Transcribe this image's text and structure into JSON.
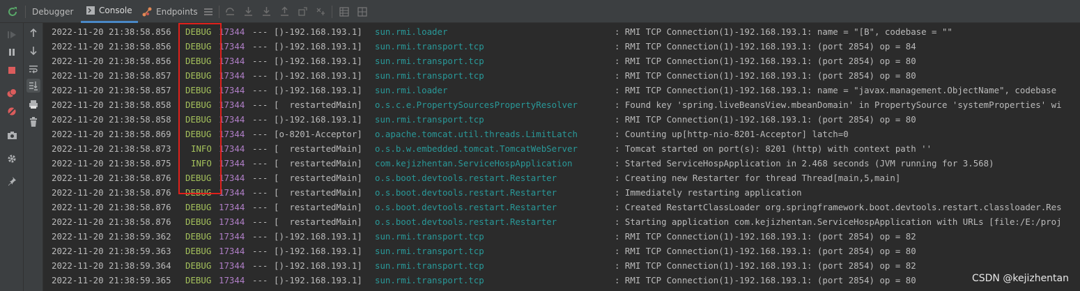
{
  "toolbar": {
    "rerun_icon": "rerun-icon",
    "tabs": [
      {
        "label": "Debugger",
        "icon": "",
        "active": false
      },
      {
        "label": "Console",
        "icon": "console-icon",
        "active": true
      },
      {
        "label": "Endpoints",
        "icon": "endpoints-icon",
        "active": false
      }
    ],
    "icons": [
      "menu-icon",
      "step-over-icon",
      "step-into-icon",
      "force-step-into-icon",
      "step-out-icon",
      "drop-frame-icon",
      "run-to-cursor-icon",
      "evaluate-icon",
      "table-icon",
      "watches-icon"
    ]
  },
  "leftbar": {
    "icons": [
      "resume-icon",
      "pause-icon",
      "stop-icon",
      "breakpoints-icon",
      "mute-breakpoints-icon",
      "camera-icon",
      "settings-icon",
      "pin-icon"
    ]
  },
  "leftbar2": {
    "icons": [
      "up-arrow-icon",
      "down-arrow-icon",
      "soft-wrap-icon",
      "scroll-to-end-icon",
      "print-icon",
      "trash-icon"
    ]
  },
  "colors": {
    "debug": "#a5c25c",
    "info": "#a5c25c",
    "pid": "#b07fc7",
    "logger": "#299999",
    "highlight": "#e0201b"
  },
  "console": {
    "lines": [
      {
        "ts": "2022-11-20 21:38:58.856",
        "level": "DEBUG",
        "pid": "17344",
        "sep": "---",
        "thread": "[)-192.168.193.1]",
        "logger": "sun.rmi.loader",
        "msg": ": RMI TCP Connection(1)-192.168.193.1: name = \"[B\", codebase = \"\""
      },
      {
        "ts": "2022-11-20 21:38:58.856",
        "level": "DEBUG",
        "pid": "17344",
        "sep": "---",
        "thread": "[)-192.168.193.1]",
        "logger": "sun.rmi.transport.tcp",
        "msg": ": RMI TCP Connection(1)-192.168.193.1: (port 2854) op = 84"
      },
      {
        "ts": "2022-11-20 21:38:58.856",
        "level": "DEBUG",
        "pid": "17344",
        "sep": "---",
        "thread": "[)-192.168.193.1]",
        "logger": "sun.rmi.transport.tcp",
        "msg": ": RMI TCP Connection(1)-192.168.193.1: (port 2854) op = 80"
      },
      {
        "ts": "2022-11-20 21:38:58.857",
        "level": "DEBUG",
        "pid": "17344",
        "sep": "---",
        "thread": "[)-192.168.193.1]",
        "logger": "sun.rmi.transport.tcp",
        "msg": ": RMI TCP Connection(1)-192.168.193.1: (port 2854) op = 80"
      },
      {
        "ts": "2022-11-20 21:38:58.857",
        "level": "DEBUG",
        "pid": "17344",
        "sep": "---",
        "thread": "[)-192.168.193.1]",
        "logger": "sun.rmi.loader",
        "msg": ": RMI TCP Connection(1)-192.168.193.1: name = \"javax.management.ObjectName\", codebase"
      },
      {
        "ts": "2022-11-20 21:38:58.858",
        "level": "DEBUG",
        "pid": "17344",
        "sep": "---",
        "thread": "[  restartedMain]",
        "logger": "o.s.c.e.PropertySourcesPropertyResolver",
        "msg": ": Found key 'spring.liveBeansView.mbeanDomain' in PropertySource 'systemProperties' wi"
      },
      {
        "ts": "2022-11-20 21:38:58.858",
        "level": "DEBUG",
        "pid": "17344",
        "sep": "---",
        "thread": "[)-192.168.193.1]",
        "logger": "sun.rmi.transport.tcp",
        "msg": ": RMI TCP Connection(1)-192.168.193.1: (port 2854) op = 80"
      },
      {
        "ts": "2022-11-20 21:38:58.869",
        "level": "DEBUG",
        "pid": "17344",
        "sep": "---",
        "thread": "[o-8201-Acceptor]",
        "logger": "o.apache.tomcat.util.threads.LimitLatch",
        "msg": ": Counting up[http-nio-8201-Acceptor] latch=0"
      },
      {
        "ts": "2022-11-20 21:38:58.873",
        "level": "INFO",
        "pid": "17344",
        "sep": "---",
        "thread": "[  restartedMain]",
        "logger": "o.s.b.w.embedded.tomcat.TomcatWebServer",
        "msg": ": Tomcat started on port(s): 8201 (http) with context path ''"
      },
      {
        "ts": "2022-11-20 21:38:58.875",
        "level": "INFO",
        "pid": "17344",
        "sep": "---",
        "thread": "[  restartedMain]",
        "logger": "com.kejizhentan.ServiceHospApplication",
        "msg": ": Started ServiceHospApplication in 2.468 seconds (JVM running for 3.568)"
      },
      {
        "ts": "2022-11-20 21:38:58.876",
        "level": "DEBUG",
        "pid": "17344",
        "sep": "---",
        "thread": "[  restartedMain]",
        "logger": "o.s.boot.devtools.restart.Restarter",
        "msg": ": Creating new Restarter for thread Thread[main,5,main]"
      },
      {
        "ts": "2022-11-20 21:38:58.876",
        "level": "DEBUG",
        "pid": "17344",
        "sep": "---",
        "thread": "[  restartedMain]",
        "logger": "o.s.boot.devtools.restart.Restarter",
        "msg": ": Immediately restarting application"
      },
      {
        "ts": "2022-11-20 21:38:58.876",
        "level": "DEBUG",
        "pid": "17344",
        "sep": "---",
        "thread": "[  restartedMain]",
        "logger": "o.s.boot.devtools.restart.Restarter",
        "msg": ": Created RestartClassLoader org.springframework.boot.devtools.restart.classloader.Res"
      },
      {
        "ts": "2022-11-20 21:38:58.876",
        "level": "DEBUG",
        "pid": "17344",
        "sep": "---",
        "thread": "[  restartedMain]",
        "logger": "o.s.boot.devtools.restart.Restarter",
        "msg": ": Starting application com.kejizhentan.ServiceHospApplication with URLs [file:/E:/proj"
      },
      {
        "ts": "2022-11-20 21:38:59.362",
        "level": "DEBUG",
        "pid": "17344",
        "sep": "---",
        "thread": "[)-192.168.193.1]",
        "logger": "sun.rmi.transport.tcp",
        "msg": ": RMI TCP Connection(1)-192.168.193.1: (port 2854) op = 82"
      },
      {
        "ts": "2022-11-20 21:38:59.363",
        "level": "DEBUG",
        "pid": "17344",
        "sep": "---",
        "thread": "[)-192.168.193.1]",
        "logger": "sun.rmi.transport.tcp",
        "msg": ": RMI TCP Connection(1)-192.168.193.1: (port 2854) op = 80"
      },
      {
        "ts": "2022-11-20 21:38:59.364",
        "level": "DEBUG",
        "pid": "17344",
        "sep": "---",
        "thread": "[)-192.168.193.1]",
        "logger": "sun.rmi.transport.tcp",
        "msg": ": RMI TCP Connection(1)-192.168.193.1: (port 2854) op = 82"
      },
      {
        "ts": "2022-11-20 21:38:59.365",
        "level": "DEBUG",
        "pid": "17344",
        "sep": "---",
        "thread": "[)-192.168.193.1]",
        "logger": "sun.rmi.transport.tcp",
        "msg": ": RMI TCP Connection(1)-192.168.193.1: (port 2854) op = 80"
      }
    ]
  },
  "watermark": "CSDN @kejizhentan"
}
